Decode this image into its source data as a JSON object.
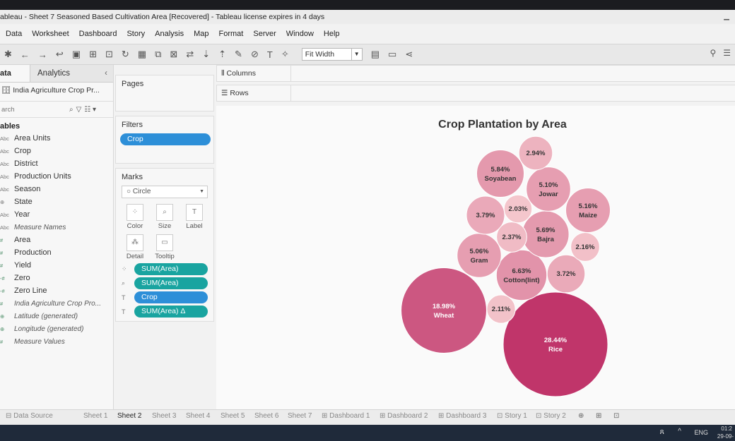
{
  "window": {
    "title": "ableau - Sheet 7 Seasoned Based Cultivation Area [Recovered] - Tableau license expires in 4 days"
  },
  "menu": [
    "Data",
    "Worksheet",
    "Dashboard",
    "Story",
    "Analysis",
    "Map",
    "Format",
    "Server",
    "Window",
    "Help"
  ],
  "toolbar": {
    "fit": "Fit Width"
  },
  "datapane": {
    "tab_data": "ata",
    "tab_analytics": "Analytics",
    "datasource": "India Agriculture Crop Pr...",
    "search_placeholder": "arch",
    "tables_heading": "ables",
    "dimensions": [
      {
        "type": "Abc",
        "name": "Area Units"
      },
      {
        "type": "Abc",
        "name": "Crop"
      },
      {
        "type": "Abc",
        "name": "District"
      },
      {
        "type": "Abc",
        "name": "Production Units"
      },
      {
        "type": "Abc",
        "name": "Season"
      },
      {
        "type": "⊕",
        "name": "State"
      },
      {
        "type": "Abc",
        "name": "Year"
      },
      {
        "type": "Abc",
        "name": "Measure Names"
      }
    ],
    "measures": [
      {
        "type": "#",
        "name": "Area"
      },
      {
        "type": "#",
        "name": "Production"
      },
      {
        "type": "#",
        "name": "Yield"
      },
      {
        "type": "-#",
        "name": "Zero"
      },
      {
        "type": "-#",
        "name": "Zero Line"
      },
      {
        "type": "#",
        "name": "India Agriculture Crop Pro..."
      },
      {
        "type": "⊕",
        "name": "Latitude (generated)"
      },
      {
        "type": "⊕",
        "name": "Longitude (generated)"
      },
      {
        "type": "#",
        "name": "Measure Values"
      }
    ]
  },
  "pages": {
    "label": "Pages"
  },
  "filters": {
    "label": "Filters",
    "pill": "Crop"
  },
  "marks": {
    "label": "Marks",
    "type": "Circle",
    "buttons": [
      "Color",
      "Size",
      "Label",
      "Detail",
      "Tooltip"
    ],
    "pills": [
      {
        "icon": "color",
        "label": "SUM(Area)",
        "kind": "green"
      },
      {
        "icon": "size",
        "label": "SUM(Area)",
        "kind": "green"
      },
      {
        "icon": "label",
        "label": "Crop",
        "kind": "blue"
      },
      {
        "icon": "label",
        "label": "SUM(Area)  Δ",
        "kind": "green"
      }
    ]
  },
  "shelves": {
    "columns": "Columns",
    "rows": "Rows"
  },
  "chart_data": {
    "type": "bubble",
    "title": "Crop Plantation by Area",
    "bubbles": [
      {
        "label": "Rice",
        "pct": "28.44%",
        "value": 28.44
      },
      {
        "label": "Wheat",
        "pct": "18.98%",
        "value": 18.98
      },
      {
        "label": "Cotton(lint)",
        "pct": "6.63%",
        "value": 6.63
      },
      {
        "label": "Soyabean",
        "pct": "5.84%",
        "value": 5.84
      },
      {
        "label": "Bajra",
        "pct": "5.69%",
        "value": 5.69
      },
      {
        "label": "Maize",
        "pct": "5.16%",
        "value": 5.16
      },
      {
        "label": "Jowar",
        "pct": "5.10%",
        "value": 5.1
      },
      {
        "label": "Gram",
        "pct": "5.06%",
        "value": 5.06
      },
      {
        "label": "",
        "pct": "3.79%",
        "value": 3.79
      },
      {
        "label": "",
        "pct": "3.72%",
        "value": 3.72
      },
      {
        "label": "",
        "pct": "2.94%",
        "value": 2.94
      },
      {
        "label": "",
        "pct": "2.37%",
        "value": 2.37
      },
      {
        "label": "",
        "pct": "2.16%",
        "value": 2.16
      },
      {
        "label": "",
        "pct": "2.11%",
        "value": 2.11
      },
      {
        "label": "",
        "pct": "2.03%",
        "value": 2.03
      }
    ],
    "colors": {
      "low": "#f4c6cc",
      "high": "#c0356a"
    }
  },
  "sheets": {
    "data_source": "Data Source",
    "tabs": [
      "Sheet 1",
      "Sheet 2",
      "Sheet 3",
      "Sheet 4",
      "Sheet 5",
      "Sheet 6",
      "Sheet 7",
      "Dashboard 1",
      "Dashboard 2",
      "Dashboard 3",
      "Story 1",
      "Story 2"
    ],
    "active": "Sheet 2"
  },
  "taskbar": {
    "lang": "ENG",
    "time": "01:2",
    "date": "29-09-"
  }
}
